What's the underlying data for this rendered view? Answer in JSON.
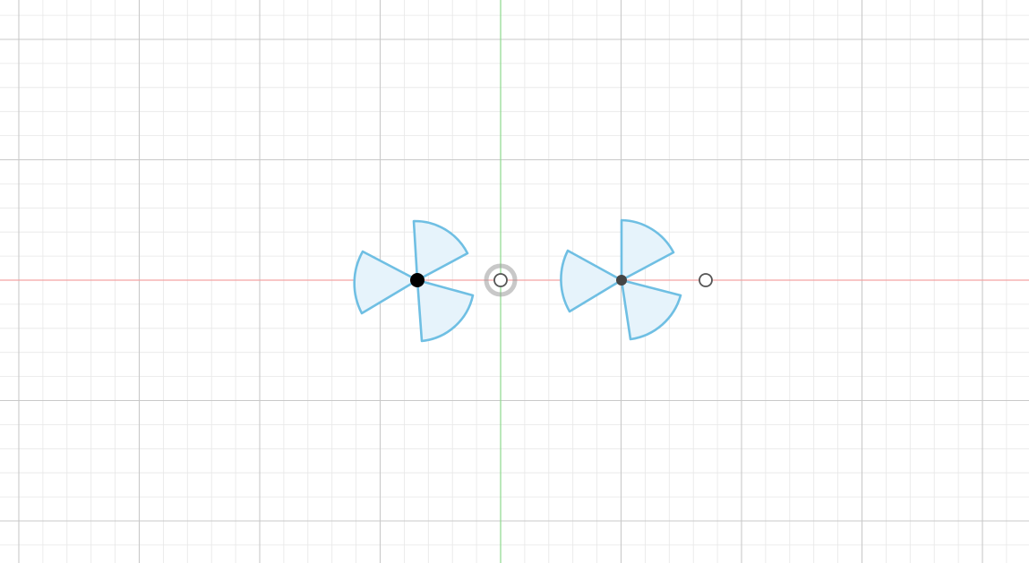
{
  "viewport": {
    "name": "sketch-canvas",
    "colors": {
      "background": "#ffffff",
      "minor_grid": "#e7e7e7",
      "major_grid": "#c9c9c9",
      "x_axis": "#f4a3a3",
      "y_axis": "#8fdc8f",
      "profile_stroke": "#6fbfe3",
      "profile_fill": "#e6f3fb",
      "point_dark": "#000000",
      "point_gray": "#444444",
      "selection_halo": "#9a9a9a"
    }
  },
  "grid": {
    "visible": true
  },
  "axes": {
    "x_axis_visible": true,
    "y_axis_visible": true
  },
  "sketch": {
    "profiles": [
      {
        "name": "propeller-profile-left",
        "blades": 3,
        "style": "fan"
      },
      {
        "name": "propeller-profile-right",
        "blades": 3,
        "style": "fan"
      }
    ],
    "points": [
      {
        "name": "center-point-left",
        "style": "filled-dark"
      },
      {
        "name": "origin-point",
        "style": "hollow-selected"
      },
      {
        "name": "center-point-right",
        "style": "filled-gray"
      },
      {
        "name": "sketch-point-right",
        "style": "hollow"
      }
    ]
  }
}
